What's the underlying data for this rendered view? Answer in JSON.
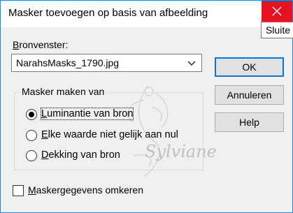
{
  "dialog": {
    "title": "Masker toevoegen op basis van afbeelding",
    "close_tooltip": "Sluite"
  },
  "source": {
    "label_underlined": "B",
    "label_rest": "ronvenster:",
    "selected": "NarahsMasks_1790.jpg"
  },
  "buttons": {
    "ok": "OK",
    "cancel": "Annuleren",
    "help": "Help"
  },
  "group": {
    "title": "Masker maken van",
    "options": [
      {
        "u": "L",
        "rest": "uminantie van bron",
        "selected": true
      },
      {
        "u": "E",
        "rest": "lke waarde niet gelijk aan nul",
        "selected": false
      },
      {
        "u": "D",
        "rest": "ekking van bron",
        "selected": false
      }
    ]
  },
  "invert": {
    "u": "M",
    "rest": "askergegevens omkeren",
    "checked": false
  },
  "watermark": {
    "text": "Sylviane"
  },
  "colors": {
    "accent": "#0078d7",
    "close_red": "#e81123"
  }
}
